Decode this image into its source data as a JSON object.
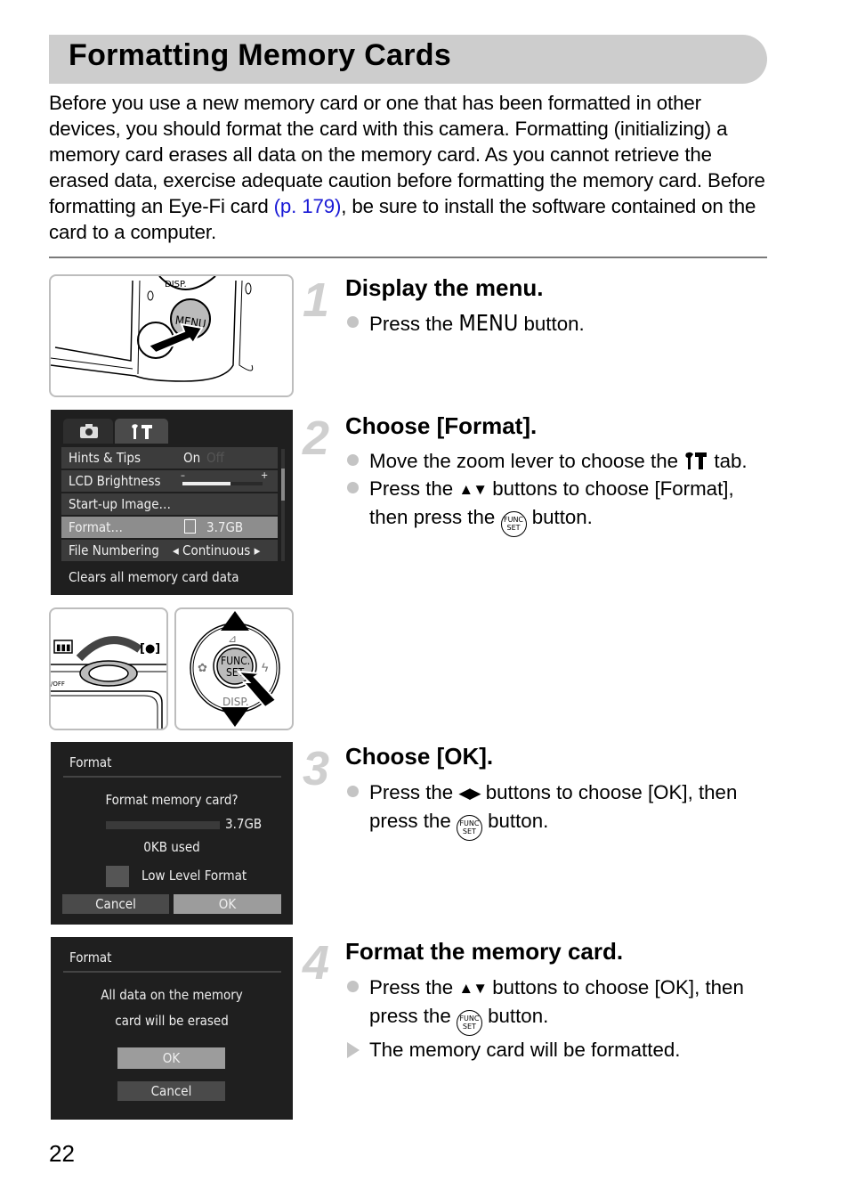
{
  "page": {
    "title": "Formatting Memory Cards",
    "intro_part1": "Before you use a new memory card or one that has been formatted in other devices, you should format the card with this camera. Formatting (initializing) a memory card erases all data on the memory card. As you cannot retrieve the erased data, exercise adequate caution before formatting the memory card. Before formatting an Eye-Fi card ",
    "intro_link": "(p. 179)",
    "intro_part2": ", be sure to install the software contained on the card to a computer.",
    "page_number": "22",
    "link_color": "#1a1ad6"
  },
  "steps": [
    {
      "number": "1",
      "title": "Display the menu.",
      "bullets": [
        {
          "pre": "Press the ",
          "glyph": "MENU",
          "post": " button."
        }
      ]
    },
    {
      "number": "2",
      "title": "Choose [Format].",
      "bullets": [
        {
          "pre": "Move the zoom lever to choose the ",
          "glyph": "¥†",
          "post": " tab."
        },
        {
          "pre": "Press the ",
          "glyph": "▲▼",
          "mid": " buttons to choose [Format], then press the ",
          "func": "FUNC SET",
          "post": " button."
        }
      ]
    },
    {
      "number": "3",
      "title": "Choose [OK].",
      "bullets": [
        {
          "pre": "Press the ",
          "glyph": "◀▶",
          "mid": " buttons to choose [OK], then press the ",
          "func": "FUNC SET",
          "post": " button."
        }
      ]
    },
    {
      "number": "4",
      "title": "Format the memory card.",
      "bullets": [
        {
          "pre": "Press the ",
          "glyph": "▲▼",
          "mid": " buttons to choose [OK], then press the ",
          "func": "FUNC SET",
          "post": " button."
        }
      ],
      "result": "The memory card will be formatted."
    }
  ],
  "camera_illustrations": {
    "menu_button_label": "MENU",
    "disp_label": "DISP.",
    "func_label": "FUNC. SET",
    "zoom_wide": "▮▮▮",
    "zoom_tele": "[●]"
  },
  "menu_screen": {
    "tabs": [
      "camera-tab",
      "setup-tab"
    ],
    "rows": [
      {
        "label": "Hints & Tips",
        "value": "On",
        "dim": "Off"
      },
      {
        "label": "LCD Brightness",
        "value": "",
        "level": 0.6
      },
      {
        "label": "Start-up Image…",
        "value": ""
      },
      {
        "label": "Format…",
        "value": "3.7GB"
      },
      {
        "label": "File Numbering",
        "value": "◂ Continuous ▸"
      }
    ],
    "help": "Clears all memory card data"
  },
  "format_dialog": {
    "title": "Format",
    "question": "Format memory card?",
    "capacity": "3.7GB",
    "used": "0KB used",
    "checkbox_label": "Low Level Format",
    "cancel": "Cancel",
    "ok": "OK"
  },
  "erase_dialog": {
    "title": "Format",
    "line1": "All data on the memory",
    "line2": "card will be erased",
    "ok": "OK",
    "cancel": "Cancel"
  }
}
